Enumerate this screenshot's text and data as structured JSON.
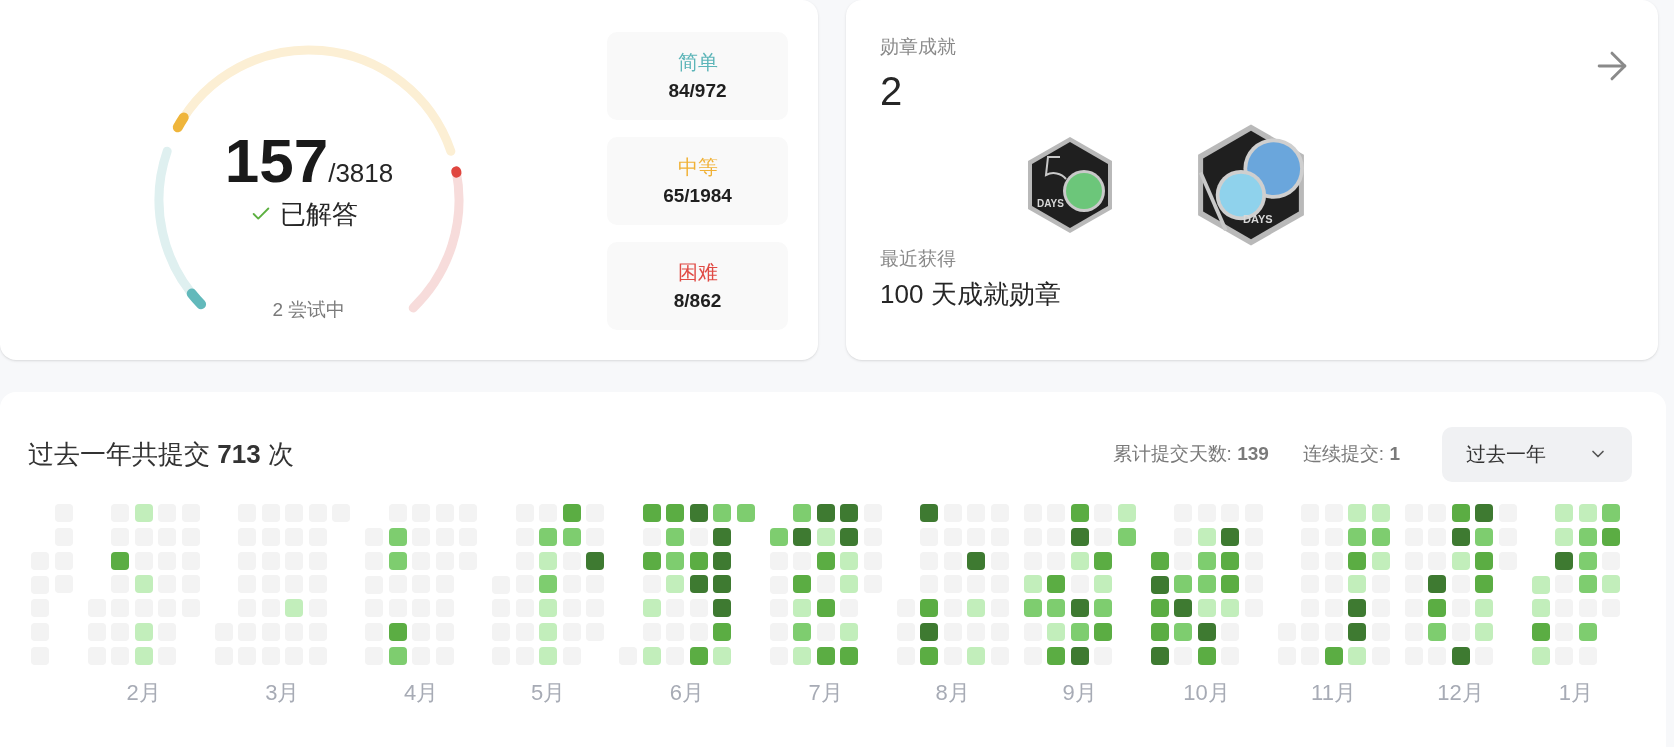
{
  "solved": {
    "count": "157",
    "total": "/3818",
    "label": "已解答",
    "attempting": "2 尝试中"
  },
  "gauge": {
    "segments": [
      {
        "kind": "easy",
        "level": 0.086
      },
      {
        "kind": "medium",
        "level": 0.033
      },
      {
        "kind": "hard",
        "level": 0.009
      }
    ]
  },
  "difficulties": [
    {
      "kind": "easy",
      "label": "简单",
      "value": "84/972"
    },
    {
      "kind": "medium",
      "label": "中等",
      "value": "65/1984"
    },
    {
      "kind": "hard",
      "label": "困难",
      "value": "8/862"
    }
  ],
  "badges_card": {
    "title": "勋章成就",
    "count": "2",
    "badges": [
      {
        "kind": "fifty",
        "caption": "DAYS"
      },
      {
        "kind": "hundred",
        "caption": "DAYS"
      }
    ],
    "recent_label": "最近获得",
    "recent_value": "100 天成就勋章"
  },
  "submissions": {
    "title": "过去一年共提交 **713** 次",
    "total_days": "累计提交天数: **139**",
    "streak": "连续提交: **1**",
    "range": "过去一年",
    "months": [
      {
        "weeks": [
          {
            "aligned_bottom": true,
            "cells": [
              {
                "color": "#f3f3f3"
              },
              {
                "color": "#f3f3f3"
              },
              {
                "color": "#f3f3f3"
              },
              {
                "color": "#f3f3f3"
              },
              {
                "color": "#f3f3f3"
              }
            ]
          },
          {
            "cells": [
              {
                "color": "#f3f3f3"
              },
              {
                "color": "#f3f3f3"
              },
              {
                "color": "#f3f3f3"
              },
              {
                "color": "#f3f3f3"
              }
            ]
          }
        ]
      },
      {
        "label": "2月",
        "weeks": [
          {
            "aligned_bottom": true,
            "cells": [
              {
                "color": "#f3f3f3"
              },
              {
                "color": "#f3f3f3"
              },
              {
                "color": "#f3f3f3"
              }
            ]
          },
          {
            "cells": [
              {
                "color": "#f3f3f3"
              },
              {
                "color": "#f3f3f3"
              },
              {
                "color": "#5bad43"
              },
              {
                "color": "#f3f3f3"
              },
              {
                "color": "#f3f3f3"
              },
              {
                "color": "#f3f3f3"
              },
              {
                "color": "#f3f3f3"
              }
            ]
          },
          {
            "cells": [
              {
                "color": "#c2eebb"
              },
              {
                "color": "#f3f3f3"
              },
              {
                "color": "#f3f3f3"
              },
              {
                "color": "#c2eebb"
              },
              {
                "color": "#f3f3f3"
              },
              {
                "color": "#c2eebb"
              },
              {
                "color": "#c2eebb"
              }
            ]
          },
          {
            "cells": [
              {
                "color": "#f3f3f3"
              },
              {
                "color": "#f3f3f3"
              },
              {
                "color": "#f3f3f3"
              },
              {
                "color": "#f3f3f3"
              },
              {
                "color": "#f3f3f3"
              },
              {
                "color": "#f3f3f3"
              },
              {
                "color": "#f3f3f3"
              }
            ]
          },
          {
            "cells": [
              {
                "color": "#f3f3f3"
              },
              {
                "color": "#f3f3f3"
              },
              {
                "color": "#f3f3f3"
              },
              {
                "color": "#f3f3f3"
              },
              {
                "color": "#f3f3f3"
              }
            ]
          }
        ]
      },
      {
        "label": "3月",
        "weeks": [
          {
            "aligned_bottom": true,
            "cells": [
              {
                "color": "#f3f3f3"
              },
              {
                "color": "#f3f3f3"
              }
            ]
          },
          {
            "cells": [
              {
                "color": "#f3f3f3"
              },
              {
                "color": "#f3f3f3"
              },
              {
                "color": "#f3f3f3"
              },
              {
                "color": "#f3f3f3"
              },
              {
                "color": "#f3f3f3"
              },
              {
                "color": "#f3f3f3"
              },
              {
                "color": "#f3f3f3"
              }
            ]
          },
          {
            "cells": [
              {
                "color": "#f3f3f3"
              },
              {
                "color": "#f3f3f3"
              },
              {
                "color": "#f3f3f3"
              },
              {
                "color": "#f3f3f3"
              },
              {
                "color": "#f3f3f3"
              },
              {
                "color": "#f3f3f3"
              },
              {
                "color": "#f3f3f3"
              }
            ]
          },
          {
            "cells": [
              {
                "color": "#f3f3f3"
              },
              {
                "color": "#f3f3f3"
              },
              {
                "color": "#f3f3f3"
              },
              {
                "color": "#f3f3f3"
              },
              {
                "color": "#c2eebb"
              },
              {
                "color": "#f3f3f3"
              },
              {
                "color": "#f3f3f3"
              }
            ]
          },
          {
            "cells": [
              {
                "color": "#f3f3f3"
              },
              {
                "color": "#f3f3f3"
              },
              {
                "color": "#f3f3f3"
              },
              {
                "color": "#f3f3f3"
              },
              {
                "color": "#f3f3f3"
              },
              {
                "color": "#f3f3f3"
              },
              {
                "color": "#f3f3f3"
              }
            ]
          },
          {
            "cells": [
              {
                "color": "#f3f3f3"
              }
            ]
          }
        ]
      },
      {
        "label": "4月",
        "weeks": [
          {
            "aligned_bottom": true,
            "cells": [
              {
                "color": "#f3f3f3"
              },
              {
                "color": "#f3f3f3"
              },
              {
                "color": "#f3f3f3"
              },
              {
                "color": "#f3f3f3"
              },
              {
                "color": "#f3f3f3"
              },
              {
                "color": "#f3f3f3"
              }
            ]
          },
          {
            "cells": [
              {
                "color": "#f3f3f3"
              },
              {
                "color": "#7ecd6f"
              },
              {
                "color": "#7ecd6f"
              },
              {
                "color": "#f3f3f3"
              },
              {
                "color": "#f3f3f3"
              },
              {
                "color": "#5bad43"
              },
              {
                "color": "#7ecd6f"
              }
            ]
          },
          {
            "cells": [
              {
                "color": "#f3f3f3"
              },
              {
                "color": "#f3f3f3"
              },
              {
                "color": "#f3f3f3"
              },
              {
                "color": "#f3f3f3"
              },
              {
                "color": "#f3f3f3"
              },
              {
                "color": "#f3f3f3"
              },
              {
                "color": "#f3f3f3"
              }
            ]
          },
          {
            "cells": [
              {
                "color": "#f3f3f3"
              },
              {
                "color": "#f3f3f3"
              },
              {
                "color": "#f3f3f3"
              },
              {
                "color": "#f3f3f3"
              },
              {
                "color": "#f3f3f3"
              },
              {
                "color": "#f3f3f3"
              },
              {
                "color": "#f3f3f3"
              }
            ]
          },
          {
            "cells": [
              {
                "color": "#f3f3f3"
              },
              {
                "color": "#f3f3f3"
              },
              {
                "color": "#f3f3f3"
              }
            ]
          }
        ]
      },
      {
        "label": "5月",
        "weeks": [
          {
            "aligned_bottom": true,
            "cells": [
              {
                "color": "#f3f3f3"
              },
              {
                "color": "#f3f3f3"
              },
              {
                "color": "#f3f3f3"
              },
              {
                "color": "#f3f3f3"
              }
            ]
          },
          {
            "cells": [
              {
                "color": "#f3f3f3"
              },
              {
                "color": "#f3f3f3"
              },
              {
                "color": "#f3f3f3"
              },
              {
                "color": "#f3f3f3"
              },
              {
                "color": "#f3f3f3"
              },
              {
                "color": "#f3f3f3"
              },
              {
                "color": "#f3f3f3"
              }
            ]
          },
          {
            "cells": [
              {
                "color": "#f3f3f3"
              },
              {
                "color": "#7ecd6f"
              },
              {
                "color": "#c2eebb"
              },
              {
                "color": "#7ecd6f"
              },
              {
                "color": "#c2eebb"
              },
              {
                "color": "#c2eebb"
              },
              {
                "color": "#c2eebb"
              }
            ]
          },
          {
            "cells": [
              {
                "color": "#5bad43"
              },
              {
                "color": "#7ecd6f"
              },
              {
                "color": "#f3f3f3"
              },
              {
                "color": "#f3f3f3"
              },
              {
                "color": "#f3f3f3"
              },
              {
                "color": "#f3f3f3"
              },
              {
                "color": "#f3f3f3"
              }
            ]
          },
          {
            "cells": [
              {
                "color": "#f3f3f3"
              },
              {
                "color": "#f3f3f3"
              },
              {
                "color": "#3e7a31"
              },
              {
                "color": "#f3f3f3"
              },
              {
                "color": "#f3f3f3"
              },
              {
                "color": "#f3f3f3"
              }
            ]
          }
        ]
      },
      {
        "label": "6月",
        "weeks": [
          {
            "aligned_bottom": true,
            "cells": [
              {
                "color": "#f3f3f3"
              }
            ]
          },
          {
            "cells": [
              {
                "color": "#5bad43"
              },
              {
                "color": "#f3f3f3"
              },
              {
                "color": "#5bad43"
              },
              {
                "color": "#f3f3f3"
              },
              {
                "color": "#c2eebb"
              },
              {
                "color": "#f3f3f3"
              },
              {
                "color": "#c2eebb"
              }
            ]
          },
          {
            "cells": [
              {
                "color": "#5bad43"
              },
              {
                "color": "#7ecd6f"
              },
              {
                "color": "#7ecd6f"
              },
              {
                "color": "#c2eebb"
              },
              {
                "color": "#f3f3f3"
              },
              {
                "color": "#f3f3f3"
              },
              {
                "color": "#f3f3f3"
              }
            ]
          },
          {
            "cells": [
              {
                "color": "#3e7a31"
              },
              {
                "color": "#f3f3f3"
              },
              {
                "color": "#5bad43"
              },
              {
                "color": "#3e7a31"
              },
              {
                "color": "#f3f3f3"
              },
              {
                "color": "#f3f3f3"
              },
              {
                "color": "#5bad43"
              }
            ]
          },
          {
            "cells": [
              {
                "color": "#7ecd6f"
              },
              {
                "color": "#3e7a31"
              },
              {
                "color": "#3e7a31"
              },
              {
                "color": "#3e7a31"
              },
              {
                "color": "#3e7a31"
              },
              {
                "color": "#5bad43"
              },
              {
                "color": "#c2eebb"
              }
            ]
          },
          {
            "cells": [
              {
                "color": "#7ecd6f"
              }
            ]
          }
        ]
      },
      {
        "label": "7月",
        "weeks": [
          {
            "aligned_bottom": true,
            "cells": [
              {
                "color": "#7ecd6f"
              },
              {
                "color": "#f3f3f3"
              },
              {
                "color": "#f3f3f3"
              },
              {
                "color": "#f3f3f3"
              },
              {
                "color": "#f3f3f3"
              },
              {
                "color": "#f3f3f3"
              }
            ]
          },
          {
            "cells": [
              {
                "color": "#7ecd6f"
              },
              {
                "color": "#3e7a31"
              },
              {
                "color": "#f3f3f3"
              },
              {
                "color": "#5bad43"
              },
              {
                "color": "#c2eebb"
              },
              {
                "color": "#7ecd6f"
              },
              {
                "color": "#c2eebb"
              }
            ]
          },
          {
            "cells": [
              {
                "color": "#3e7a31"
              },
              {
                "color": "#c2eebb"
              },
              {
                "color": "#5bad43"
              },
              {
                "color": "#f3f3f3"
              },
              {
                "color": "#5bad43"
              },
              {
                "color": "#f3f3f3"
              },
              {
                "color": "#5bad43"
              }
            ]
          },
          {
            "cells": [
              {
                "color": "#3e7a31"
              },
              {
                "color": "#3e7a31"
              },
              {
                "color": "#c2eebb"
              },
              {
                "color": "#c2eebb"
              },
              {
                "color": "#f3f3f3"
              },
              {
                "color": "#c2eebb"
              },
              {
                "color": "#5bad43"
              }
            ]
          },
          {
            "cells": [
              {
                "color": "#f3f3f3"
              },
              {
                "color": "#f3f3f3"
              },
              {
                "color": "#f3f3f3"
              },
              {
                "color": "#f3f3f3"
              }
            ]
          }
        ]
      },
      {
        "label": "8月",
        "weeks": [
          {
            "aligned_bottom": true,
            "cells": [
              {
                "color": "#f3f3f3"
              },
              {
                "color": "#f3f3f3"
              },
              {
                "color": "#f3f3f3"
              }
            ]
          },
          {
            "cells": [
              {
                "color": "#3e7a31"
              },
              {
                "color": "#f3f3f3"
              },
              {
                "color": "#f3f3f3"
              },
              {
                "color": "#f3f3f3"
              },
              {
                "color": "#5bad43"
              },
              {
                "color": "#3e7a31"
              },
              {
                "color": "#5bad43"
              }
            ]
          },
          {
            "cells": [
              {
                "color": "#f3f3f3"
              },
              {
                "color": "#f3f3f3"
              },
              {
                "color": "#f3f3f3"
              },
              {
                "color": "#f3f3f3"
              },
              {
                "color": "#f3f3f3"
              },
              {
                "color": "#f3f3f3"
              },
              {
                "color": "#f3f3f3"
              }
            ]
          },
          {
            "cells": [
              {
                "color": "#f3f3f3"
              },
              {
                "color": "#f3f3f3"
              },
              {
                "color": "#3e7a31"
              },
              {
                "color": "#f3f3f3"
              },
              {
                "color": "#c2eebb"
              },
              {
                "color": "#f3f3f3"
              },
              {
                "color": "#c2eebb"
              }
            ]
          },
          {
            "cells": [
              {
                "color": "#f3f3f3"
              },
              {
                "color": "#f3f3f3"
              },
              {
                "color": "#f3f3f3"
              },
              {
                "color": "#f3f3f3"
              },
              {
                "color": "#f3f3f3"
              },
              {
                "color": "#f3f3f3"
              },
              {
                "color": "#f3f3f3"
              }
            ]
          }
        ]
      },
      {
        "label": "9月",
        "weeks": [
          {
            "cells": [
              {
                "color": "#f3f3f3"
              },
              {
                "color": "#f3f3f3"
              },
              {
                "color": "#f3f3f3"
              },
              {
                "color": "#c2eebb"
              },
              {
                "color": "#7ecd6f"
              },
              {
                "color": "#f3f3f3"
              },
              {
                "color": "#f3f3f3"
              }
            ]
          },
          {
            "cells": [
              {
                "color": "#f3f3f3"
              },
              {
                "color": "#f3f3f3"
              },
              {
                "color": "#f3f3f3"
              },
              {
                "color": "#5bad43"
              },
              {
                "color": "#7ecd6f"
              },
              {
                "color": "#c2eebb"
              },
              {
                "color": "#5bad43"
              }
            ]
          },
          {
            "cells": [
              {
                "color": "#5bad43"
              },
              {
                "color": "#3e7a31"
              },
              {
                "color": "#c2eebb"
              },
              {
                "color": "#f3f3f3"
              },
              {
                "color": "#3e7a31"
              },
              {
                "color": "#7ecd6f"
              },
              {
                "color": "#3e7a31"
              }
            ]
          },
          {
            "cells": [
              {
                "color": "#f3f3f3"
              },
              {
                "color": "#f3f3f3"
              },
              {
                "color": "#5bad43"
              },
              {
                "color": "#c2eebb"
              },
              {
                "color": "#7ecd6f"
              },
              {
                "color": "#5bad43"
              },
              {
                "color": "#f3f3f3"
              }
            ]
          },
          {
            "cells": [
              {
                "color": "#c2eebb"
              },
              {
                "color": "#7ecd6f"
              }
            ]
          }
        ]
      },
      {
        "label": "10月",
        "weeks": [
          {
            "aligned_bottom": true,
            "cells": [
              {
                "color": "#5bad43"
              },
              {
                "color": "#3e7a31"
              },
              {
                "color": "#5bad43"
              },
              {
                "color": "#5bad43"
              },
              {
                "color": "#3e7a31"
              }
            ]
          },
          {
            "cells": [
              {
                "color": "#f3f3f3"
              },
              {
                "color": "#f3f3f3"
              },
              {
                "color": "#f3f3f3"
              },
              {
                "color": "#7ecd6f"
              },
              {
                "color": "#3e7a31"
              },
              {
                "color": "#7ecd6f"
              },
              {
                "color": "#f3f3f3"
              }
            ]
          },
          {
            "cells": [
              {
                "color": "#f3f3f3"
              },
              {
                "color": "#c2eebb"
              },
              {
                "color": "#7ecd6f"
              },
              {
                "color": "#7ecd6f"
              },
              {
                "color": "#c2eebb"
              },
              {
                "color": "#3e7a31"
              },
              {
                "color": "#5bad43"
              }
            ]
          },
          {
            "cells": [
              {
                "color": "#f3f3f3"
              },
              {
                "color": "#3e7a31"
              },
              {
                "color": "#5bad43"
              },
              {
                "color": "#5bad43"
              },
              {
                "color": "#c2eebb"
              },
              {
                "color": "#f3f3f3"
              },
              {
                "color": "#f3f3f3"
              }
            ]
          },
          {
            "cells": [
              {
                "color": "#f3f3f3"
              },
              {
                "color": "#f3f3f3"
              },
              {
                "color": "#f3f3f3"
              },
              {
                "color": "#f3f3f3"
              },
              {
                "color": "#f3f3f3"
              }
            ]
          }
        ]
      },
      {
        "label": "11月",
        "weeks": [
          {
            "aligned_bottom": true,
            "cells": [
              {
                "color": "#f3f3f3"
              },
              {
                "color": "#f3f3f3"
              }
            ]
          },
          {
            "cells": [
              {
                "color": "#f3f3f3"
              },
              {
                "color": "#f3f3f3"
              },
              {
                "color": "#f3f3f3"
              },
              {
                "color": "#f3f3f3"
              },
              {
                "color": "#f3f3f3"
              },
              {
                "color": "#f3f3f3"
              },
              {
                "color": "#f3f3f3"
              }
            ]
          },
          {
            "cells": [
              {
                "color": "#f3f3f3"
              },
              {
                "color": "#f3f3f3"
              },
              {
                "color": "#f3f3f3"
              },
              {
                "color": "#f3f3f3"
              },
              {
                "color": "#f3f3f3"
              },
              {
                "color": "#f3f3f3"
              },
              {
                "color": "#5bad43"
              }
            ]
          },
          {
            "cells": [
              {
                "color": "#c2eebb"
              },
              {
                "color": "#7ecd6f"
              },
              {
                "color": "#5bad43"
              },
              {
                "color": "#c2eebb"
              },
              {
                "color": "#3e7a31"
              },
              {
                "color": "#3e7a31"
              },
              {
                "color": "#c2eebb"
              }
            ]
          },
          {
            "cells": [
              {
                "color": "#c2eebb"
              },
              {
                "color": "#7ecd6f"
              },
              {
                "color": "#c2eebb"
              },
              {
                "color": "#f3f3f3"
              },
              {
                "color": "#f3f3f3"
              },
              {
                "color": "#f3f3f3"
              },
              {
                "color": "#f3f3f3"
              }
            ]
          }
        ]
      },
      {
        "label": "12月",
        "weeks": [
          {
            "cells": [
              {
                "color": "#f3f3f3"
              },
              {
                "color": "#f3f3f3"
              },
              {
                "color": "#f3f3f3"
              },
              {
                "color": "#f3f3f3"
              },
              {
                "color": "#f3f3f3"
              },
              {
                "color": "#f3f3f3"
              },
              {
                "color": "#f3f3f3"
              }
            ]
          },
          {
            "cells": [
              {
                "color": "#f3f3f3"
              },
              {
                "color": "#f3f3f3"
              },
              {
                "color": "#f3f3f3"
              },
              {
                "color": "#3e7a31"
              },
              {
                "color": "#5bad43"
              },
              {
                "color": "#7ecd6f"
              },
              {
                "color": "#f3f3f3"
              }
            ]
          },
          {
            "cells": [
              {
                "color": "#5bad43"
              },
              {
                "color": "#3e7a31"
              },
              {
                "color": "#c2eebb"
              },
              {
                "color": "#f3f3f3"
              },
              {
                "color": "#f3f3f3"
              },
              {
                "color": "#f3f3f3"
              },
              {
                "color": "#3e7a31"
              }
            ]
          },
          {
            "cells": [
              {
                "color": "#3e7a31"
              },
              {
                "color": "#7ecd6f"
              },
              {
                "color": "#5bad43"
              },
              {
                "color": "#5bad43"
              },
              {
                "color": "#c2eebb"
              },
              {
                "color": "#c2eebb"
              },
              {
                "color": "#f3f3f3"
              }
            ]
          },
          {
            "cells": [
              {
                "color": "#f3f3f3"
              },
              {
                "color": "#f3f3f3"
              },
              {
                "color": "#f3f3f3"
              }
            ]
          }
        ]
      },
      {
        "label": "1月",
        "weeks": [
          {
            "aligned_bottom": true,
            "cells": [
              {
                "color": "#c2eebb"
              },
              {
                "color": "#c2eebb"
              },
              {
                "color": "#5bad43"
              },
              {
                "color": "#c2eebb"
              }
            ]
          },
          {
            "cells": [
              {
                "color": "#c2eebb"
              },
              {
                "color": "#c2eebb"
              },
              {
                "color": "#3e7a31"
              },
              {
                "color": "#f3f3f3"
              },
              {
                "color": "#f3f3f3"
              },
              {
                "color": "#f3f3f3"
              },
              {
                "color": "#f3f3f3"
              }
            ]
          },
          {
            "cells": [
              {
                "color": "#c2eebb"
              },
              {
                "color": "#7ecd6f"
              },
              {
                "color": "#7ecd6f"
              },
              {
                "color": "#7ecd6f"
              },
              {
                "color": "#f3f3f3"
              },
              {
                "color": "#7ecd6f"
              },
              {
                "color": "#f3f3f3"
              }
            ]
          },
          {
            "cells": [
              {
                "color": "#7ecd6f"
              },
              {
                "color": "#5bad43"
              },
              {
                "color": "#f3f3f3"
              },
              {
                "color": "#c2eebb"
              },
              {
                "color": "#f3f3f3"
              }
            ]
          }
        ]
      }
    ]
  }
}
